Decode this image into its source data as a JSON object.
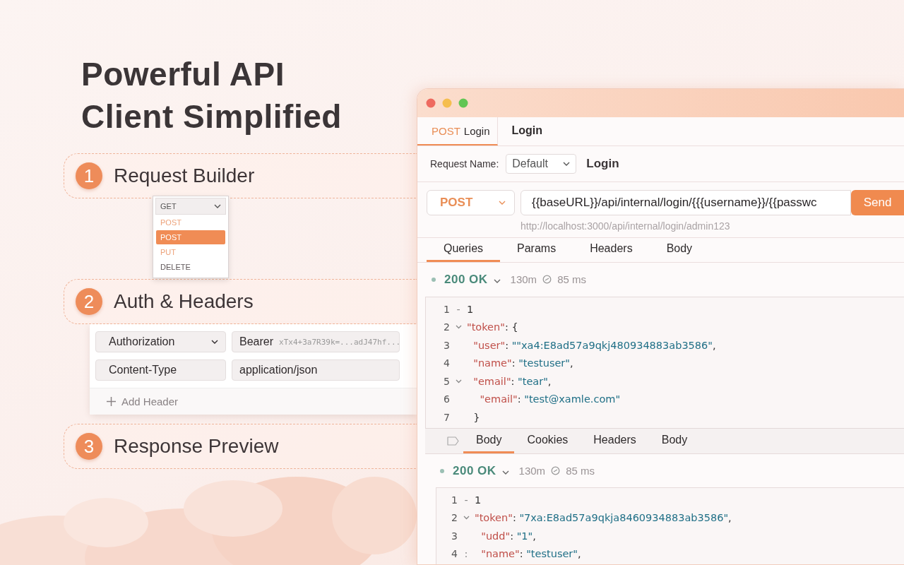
{
  "headline": [
    "Powerful API",
    "Client Simplified"
  ],
  "sections": [
    {
      "number": "1",
      "title": "Request Builder"
    },
    {
      "number": "2",
      "title": "Auth & Headers"
    },
    {
      "number": "3",
      "title": "Response Preview"
    }
  ],
  "method_menu": {
    "value": "GET",
    "options": [
      {
        "label": "POST",
        "selected": false,
        "color": "#eda27a"
      },
      {
        "label": "POST",
        "selected": true,
        "color": "#ffffff"
      },
      {
        "label": "PUT",
        "selected": false,
        "color": "#eda27a"
      },
      {
        "label": "DELETE",
        "selected": false,
        "color": "#5e5658"
      }
    ]
  },
  "headers": {
    "rows": [
      {
        "name": "Authorization",
        "dropdown": true,
        "value": "Bearer",
        "detail": "xTx4+3a7R39k=...adJ47hf..."
      },
      {
        "name": "Content-Type",
        "dropdown": false,
        "value": "application/json"
      }
    ],
    "add_label": "Add Header"
  },
  "window": {
    "tabs": [
      {
        "method": "POST",
        "label": "Login",
        "selected": true
      },
      {
        "label": "Login",
        "selected": false
      }
    ],
    "request_name": {
      "label": "Request Name:",
      "value": "Default",
      "name": "Login"
    },
    "method": "POST",
    "url": "{{baseURL}}/api/internal/login/{{{username}}/{{passwc",
    "send": "Send",
    "resolved_url": "http://localhost:3000/api/internal/login/admin123",
    "request_tabs": [
      {
        "label": "Queries",
        "selected": true
      },
      {
        "label": "Params",
        "selected": false
      },
      {
        "label": "Headers",
        "selected": false
      },
      {
        "label": "Body",
        "selected": false
      }
    ],
    "response": {
      "status": "200 OK",
      "size": "130m",
      "time": "85 ms",
      "lines": [
        {
          "number": "1",
          "gutter": "-",
          "parts": [
            {
              "kind": "punct",
              "text": "1"
            }
          ]
        },
        {
          "number": "2",
          "foldable": true,
          "parts": [
            {
              "kind": "key",
              "text": "\"token\""
            },
            {
              "kind": "punct",
              "text": ": {"
            }
          ]
        },
        {
          "number": "3",
          "parts": [
            {
              "kind": "key",
              "text": "  \"user\""
            },
            {
              "kind": "punct",
              "text": ": "
            },
            {
              "kind": "string",
              "text": "\"\"xa4:E8ad57a9qkj480934883ab3586\""
            },
            {
              "kind": "punct",
              "text": ","
            }
          ]
        },
        {
          "number": "4",
          "parts": [
            {
              "kind": "key",
              "text": "  \"name\""
            },
            {
              "kind": "punct",
              "text": ": "
            },
            {
              "kind": "string",
              "text": "\"testuser\""
            },
            {
              "kind": "punct",
              "text": ","
            }
          ]
        },
        {
          "number": "5",
          "foldable": true,
          "parts": [
            {
              "kind": "key",
              "text": "  \"email\""
            },
            {
              "kind": "punct",
              "text": ": "
            },
            {
              "kind": "string",
              "text": "\"tear\""
            },
            {
              "kind": "punct",
              "text": ","
            }
          ]
        },
        {
          "number": "6",
          "parts": [
            {
              "kind": "key",
              "text": "    \"email\""
            },
            {
              "kind": "punct",
              "text": ": "
            },
            {
              "kind": "string",
              "text": "\"test@xamle.com\""
            }
          ]
        },
        {
          "number": "7",
          "parts": [
            {
              "kind": "punct",
              "text": "  }"
            }
          ]
        }
      ]
    },
    "response_tabs": [
      {
        "label": "Body",
        "selected": true
      },
      {
        "label": "Cookies",
        "selected": false
      },
      {
        "label": "Headers",
        "selected": false
      },
      {
        "label": "Body",
        "selected": false
      }
    ],
    "preview": {
      "status": "200 OK",
      "size": "130m",
      "time": "85 ms",
      "lines": [
        {
          "number": "1",
          "gutter": "-",
          "parts": [
            {
              "kind": "punct",
              "text": "1"
            }
          ]
        },
        {
          "number": "2",
          "foldable": true,
          "parts": [
            {
              "kind": "key",
              "text": "\"token\""
            },
            {
              "kind": "punct",
              "text": ": "
            },
            {
              "kind": "string",
              "text": "\"7xa:E8ad57a9qkja8460934883ab3586\""
            },
            {
              "kind": "punct",
              "text": ","
            }
          ]
        },
        {
          "number": "3",
          "parts": [
            {
              "kind": "key",
              "text": "  \"udd\""
            },
            {
              "kind": "punct",
              "text": ": "
            },
            {
              "kind": "string",
              "text": "\"1\""
            },
            {
              "kind": "punct",
              "text": ","
            }
          ]
        },
        {
          "number": "4",
          "gutter": ":",
          "parts": [
            {
              "kind": "key",
              "text": "  \"name\""
            },
            {
              "kind": "punct",
              "text": ": "
            },
            {
              "kind": "string",
              "text": "\"testuser\""
            },
            {
              "kind": "punct",
              "text": ","
            }
          ]
        }
      ]
    }
  }
}
